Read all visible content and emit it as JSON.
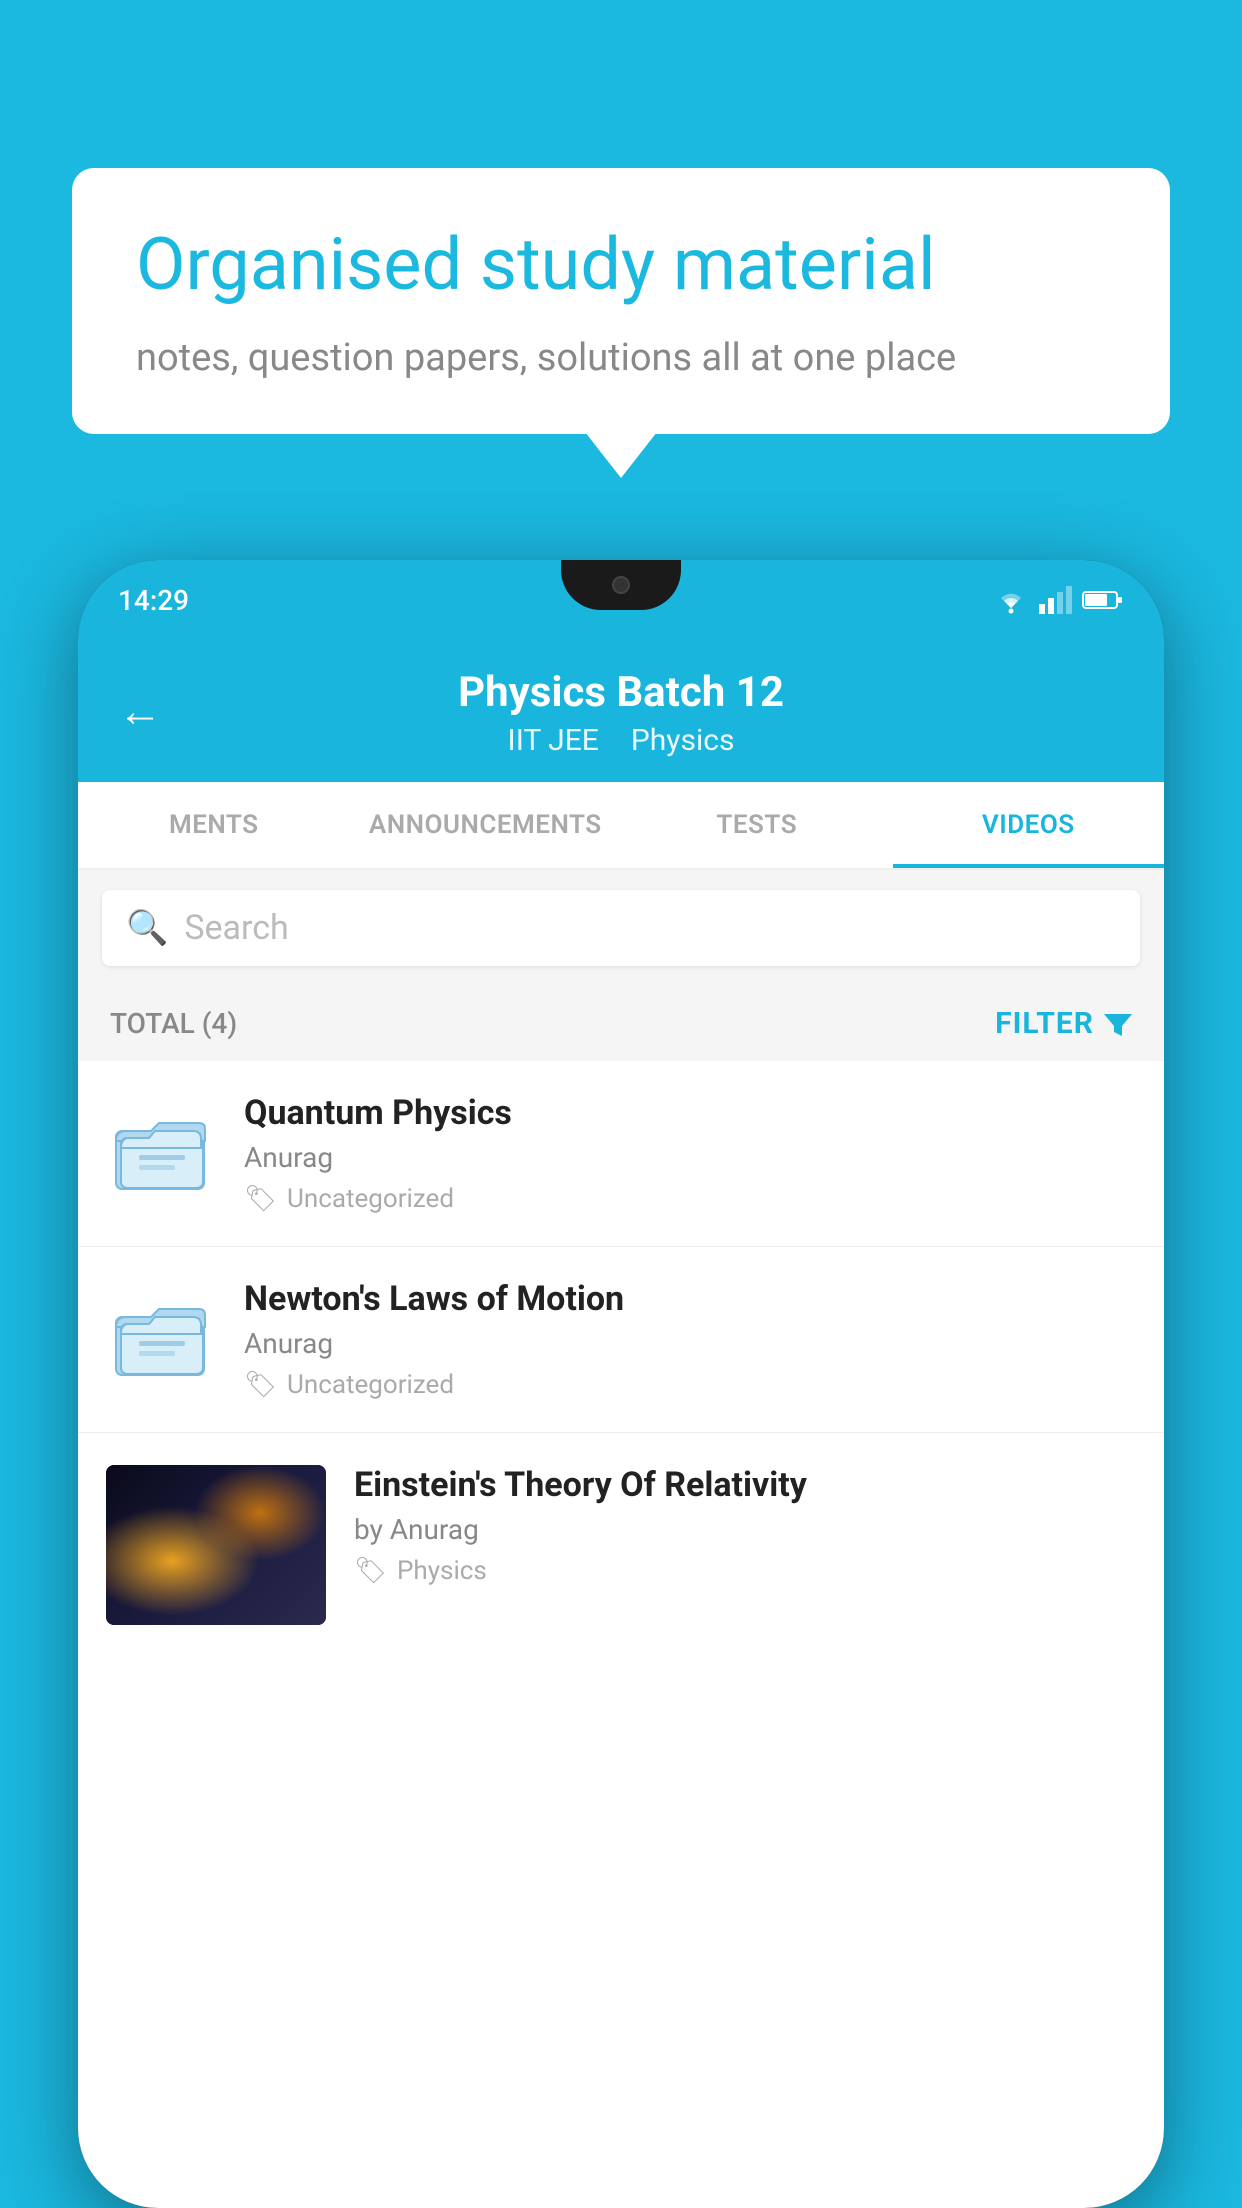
{
  "background_color": "#1bb8e0",
  "speech_bubble": {
    "title": "Organised study material",
    "subtitle": "notes, question papers, solutions all at one place"
  },
  "phone": {
    "time": "14:29",
    "header": {
      "back_label": "←",
      "batch_title": "Physics Batch 12",
      "subtitle_part1": "IIT JEE",
      "subtitle_part2": "Physics"
    },
    "tabs": [
      {
        "label": "MENTS",
        "active": false
      },
      {
        "label": "ANNOUNCEMENTS",
        "active": false
      },
      {
        "label": "TESTS",
        "active": false
      },
      {
        "label": "VIDEOS",
        "active": true
      }
    ],
    "search": {
      "placeholder": "Search"
    },
    "filter": {
      "total_label": "TOTAL (4)",
      "button_label": "FILTER"
    },
    "videos": [
      {
        "id": 1,
        "title": "Quantum Physics",
        "author": "Anurag",
        "tag": "Uncategorized",
        "type": "folder"
      },
      {
        "id": 2,
        "title": "Newton's Laws of Motion",
        "author": "Anurag",
        "tag": "Uncategorized",
        "type": "folder"
      },
      {
        "id": 3,
        "title": "Einstein's Theory Of Relativity",
        "author": "by Anurag",
        "tag": "Physics",
        "type": "video"
      }
    ]
  }
}
